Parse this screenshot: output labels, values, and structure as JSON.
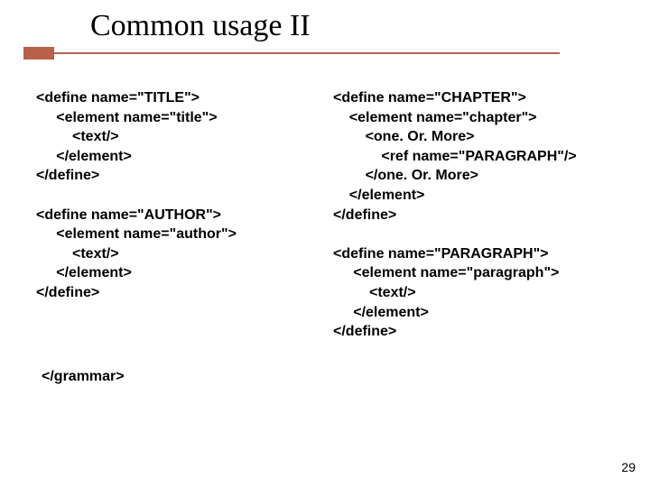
{
  "title": "Common usage II",
  "leftColumn": "<define name=\"TITLE\">\n     <element name=\"title\">\n         <text/>\n     </element>\n</define>\n\n<define name=\"AUTHOR\">\n     <element name=\"author\">\n         <text/>\n     </element>\n</define>",
  "rightColumn": "<define name=\"CHAPTER\">\n    <element name=\"chapter\">\n        <one. Or. More>\n            <ref name=\"PARAGRAPH\"/>\n        </one. Or. More>\n    </element>\n</define>\n\n<define name=\"PARAGRAPH\">\n     <element name=\"paragraph\">\n         <text/>\n     </element>\n</define>",
  "grammarClose": "</grammar>",
  "pageNumber": "29",
  "accentColor": "#b7604a"
}
